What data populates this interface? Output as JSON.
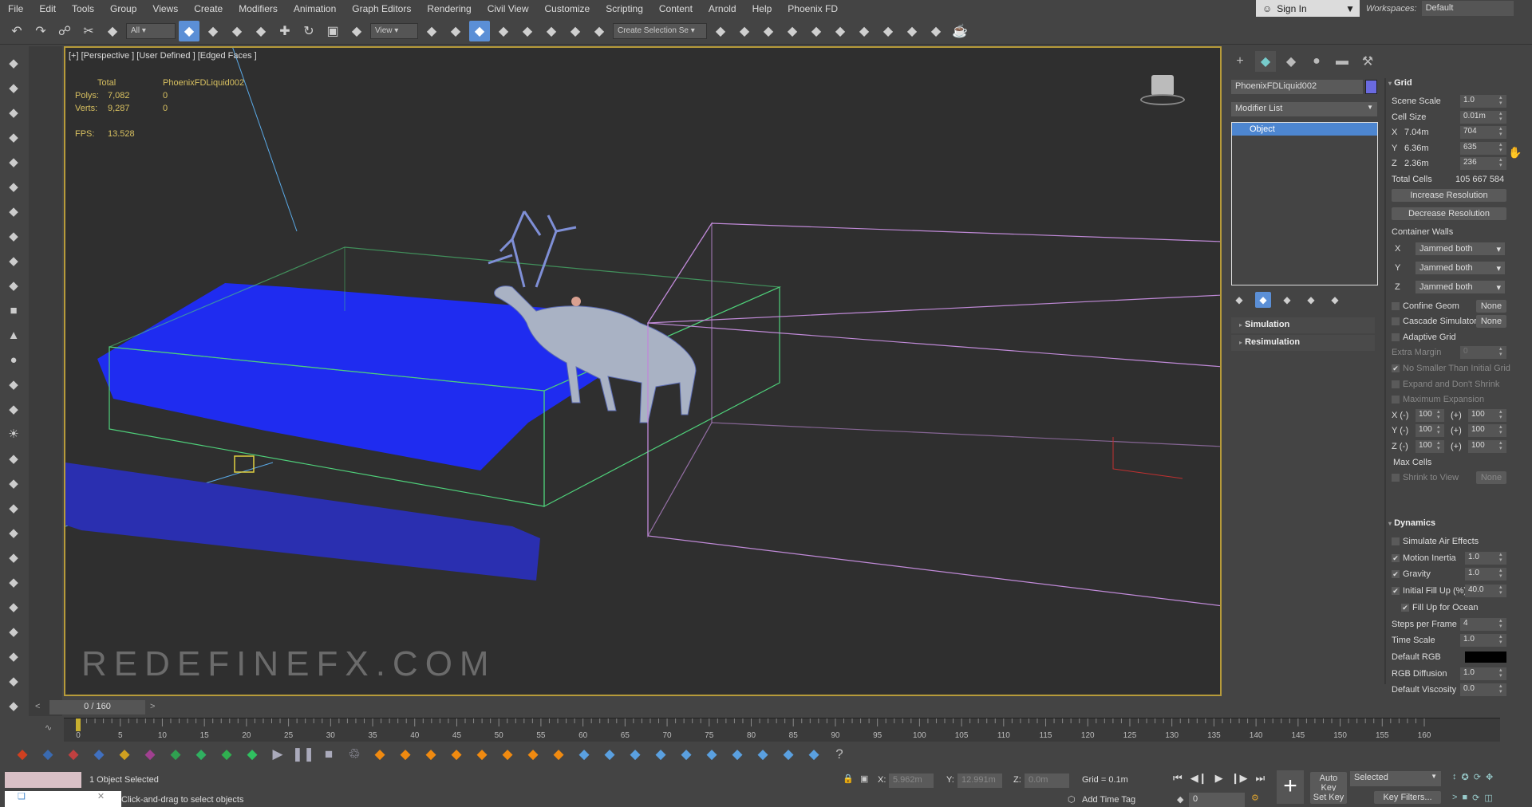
{
  "menu": [
    "File",
    "Edit",
    "Tools",
    "Group",
    "Views",
    "Create",
    "Modifiers",
    "Animation",
    "Graph Editors",
    "Rendering",
    "Civil View",
    "Customize",
    "Scripting",
    "Content",
    "Arnold",
    "Help",
    "Phoenix FD"
  ],
  "account": {
    "signin": "Sign In",
    "workspaces_label": "Workspaces:",
    "workspace": "Default"
  },
  "toolbar": {
    "icons": [
      "undo-icon",
      "redo-icon",
      "link-icon",
      "unlink-icon",
      "bind-spacewarp-icon"
    ],
    "filter": "All",
    "icons2": [
      "select-object-icon",
      "select-by-name-icon",
      "rect-selection-icon",
      "window-crossing-icon",
      "move-icon",
      "rotate-icon",
      "scale-icon",
      "placement-icon"
    ],
    "coord": "View",
    "icons3": [
      "pivot-icon",
      "manipulate-icon",
      "keyboard-shortcut-icon",
      "snaps-icon",
      "angle-snap-icon",
      "percent-snap-icon",
      "spinner-snap-icon",
      "edit-named-sel-icon"
    ],
    "named_selection": "Create Selection Se",
    "icons4": [
      "mirror-icon",
      "align-icon",
      "scene-explorer-icon",
      "layer-explorer-icon",
      "ribbon-icon",
      "curve-editor-icon",
      "schematic-icon",
      "material-editor-icon",
      "render-setup-icon",
      "rendered-frame-icon",
      "render-icon"
    ]
  },
  "left_toolbar": [
    "viewport-layout-icon",
    "cloud-icon",
    "panel-icon",
    "panel-icon",
    "panel-icon",
    "sphere-light-icon",
    "particle-icon",
    "teapot-icon",
    "camera-icon",
    "film-icon",
    "box-icon",
    "cone-icon",
    "sphere-icon",
    "torus-icon",
    "pyramid-icon",
    "sun-icon",
    "sphere2-icon",
    "grid-icon",
    "spline-icon",
    "gizmo-icon",
    "globe-icon",
    "plant-icon",
    "hair-icon",
    "fur-icon",
    "snail-icon",
    "ball-icon",
    "cube-icon"
  ],
  "viewport": {
    "label": "[+] [Perspective ] [User Defined ] [Edged Faces ]",
    "stats": {
      "total_label": "Total",
      "object": "PhoenixFDLiquid002",
      "polys_label": "Polys:",
      "polys_total": "7,082",
      "polys_obj": "0",
      "verts_label": "Verts:",
      "verts_total": "9,287",
      "verts_obj": "0",
      "fps_label": "FPS:",
      "fps": "13.528"
    },
    "watermark": "REDEFINEFX.COM",
    "colors": {
      "liquid": "#1f2cf0",
      "container_selected": "#4fd07a",
      "container_other": "#c08ad8",
      "slab": "#2a2fb0"
    }
  },
  "command_panel": {
    "tabs": [
      "create-icon",
      "modify-icon",
      "hierarchy-icon",
      "motion-icon",
      "display-icon",
      "utilities-icon"
    ],
    "object_name": "PhoenixFDLiquid002",
    "object_color": "#6a6ae0",
    "modifier_list": "Modifier List",
    "stack": [
      "Object"
    ],
    "stack_tools": [
      "pin-stack-icon",
      "show-end-result-icon",
      "make-unique-icon",
      "remove-modifier-icon",
      "configure-sets-icon"
    ],
    "rollouts": [
      "Simulation",
      "Resimulation"
    ]
  },
  "grid": {
    "title": "Grid",
    "rows": [
      {
        "type": "spin",
        "label": "Scene Scale",
        "value": "1.0"
      },
      {
        "type": "spin",
        "label": "Cell Size",
        "value": "0.01m"
      },
      {
        "type": "spin",
        "label": "X",
        "sub": "7.04m",
        "value": "704"
      },
      {
        "type": "spin",
        "label": "Y",
        "sub": "6.36m",
        "value": "635"
      },
      {
        "type": "spin",
        "label": "Z",
        "sub": "2.36m",
        "value": "236"
      },
      {
        "type": "text",
        "label": "Total Cells",
        "value": "105 667 584"
      },
      {
        "type": "button",
        "label": "Increase Resolution"
      },
      {
        "type": "button",
        "label": "Decrease Resolution"
      },
      {
        "type": "group",
        "label": "Container Walls"
      },
      {
        "type": "drop",
        "label": "X",
        "value": "Jammed both"
      },
      {
        "type": "drop",
        "label": "Y",
        "value": "Jammed both"
      },
      {
        "type": "drop",
        "label": "Z",
        "value": "Jammed both"
      },
      {
        "type": "checkbtn",
        "label": "Confine Geom",
        "value": "None",
        "checked": false
      },
      {
        "type": "checkbtn",
        "label": "Cascade Simulator",
        "value": "None",
        "checked": false
      },
      {
        "type": "check",
        "label": "Adaptive Grid",
        "checked": false
      },
      {
        "type": "spin",
        "label": "Extra Margin",
        "value": "0",
        "disabled": true
      },
      {
        "type": "check",
        "label": "No Smaller Than Initial Grid",
        "checked": true,
        "disabled": true
      },
      {
        "type": "check",
        "label": "Expand and Don't Shrink",
        "checked": false,
        "disabled": true
      },
      {
        "type": "check",
        "label": "Maximum Expansion",
        "checked": false,
        "disabled": true
      },
      {
        "type": "pair",
        "label": "X (-)",
        "value": "100",
        "plus": "(+)",
        "value2": "100"
      },
      {
        "type": "pair",
        "label": "Y (-)",
        "value": "100",
        "plus": "(+)",
        "value2": "100"
      },
      {
        "type": "pair",
        "label": "Z (-)",
        "value": "100",
        "plus": "(+)",
        "value2": "100"
      },
      {
        "type": "label",
        "label": "Max Cells"
      },
      {
        "type": "checkbtn",
        "label": "Shrink to View",
        "value": "None",
        "checked": false,
        "disabled": true
      }
    ]
  },
  "dynamics": {
    "title": "Dynamics",
    "rows": [
      {
        "type": "check",
        "label": "Simulate Air Effects",
        "checked": false
      },
      {
        "type": "checkspin",
        "label": "Motion Inertia",
        "value": "1.0",
        "checked": true
      },
      {
        "type": "checkspin",
        "label": "Gravity",
        "value": "1.0",
        "checked": true
      },
      {
        "type": "checkspin",
        "label": "Initial Fill Up (%)",
        "value": "40.0",
        "checked": true
      },
      {
        "type": "check",
        "label": "Fill Up for Ocean",
        "checked": true,
        "indent": true
      },
      {
        "type": "spin",
        "label": "Steps per Frame",
        "value": "4"
      },
      {
        "type": "spin",
        "label": "Time Scale",
        "value": "1.0"
      },
      {
        "type": "color",
        "label": "Default RGB",
        "value": "#000000"
      },
      {
        "type": "spin",
        "label": "RGB Diffusion",
        "value": "1.0"
      },
      {
        "type": "spin",
        "label": "Default Viscosity",
        "value": "0.0"
      }
    ]
  },
  "timeline": {
    "frame": "0 / 160",
    "start": 0,
    "end": 160,
    "current": 0,
    "major_step": 5
  },
  "phoenix_toolbar": [
    "liquid-sim-icon",
    "fire-sim-icon",
    "fire-source-icon",
    "liquid-source-icon",
    "particle-shader-icon",
    "foam-icon",
    "plain-force-icon",
    "turbulence-icon",
    "particle-tuner-icon",
    "body-force-icon",
    "start-sim-icon",
    "pause-sim-icon",
    "stop-sim-icon",
    "delete-cache-icon",
    "fire-preset-icon",
    "candle-preset-icon",
    "explosion-preset-icon",
    "fuel-preset-icon",
    "smoke-preset-icon",
    "steam-preset-icon",
    "campfire-preset-icon",
    "cigarette-preset-icon",
    "water-preset-icon",
    "milk-preset-icon",
    "beer-preset-icon",
    "coffee-preset-icon",
    "honey-preset-icon",
    "lava-preset-icon",
    "paint-preset-icon",
    "ocean-preset-icon",
    "waterfall-preset-icon",
    "pool-preset-icon",
    "help-icon"
  ],
  "status": {
    "selected": "1 Object Selected",
    "prompt": "Click-and-drag to select objects",
    "x_label": "X:",
    "x": "5.962m",
    "y_label": "Y:",
    "y": "12.991m",
    "z_label": "Z:",
    "z": "0.0m",
    "grid": "Grid = 0.1m",
    "add_time_tag": "Add Time Tag",
    "frame": "0",
    "auto_key": "Auto Key",
    "set_key": "Set Key",
    "key_mode": "Selected",
    "key_filters": "Key Filters..."
  }
}
